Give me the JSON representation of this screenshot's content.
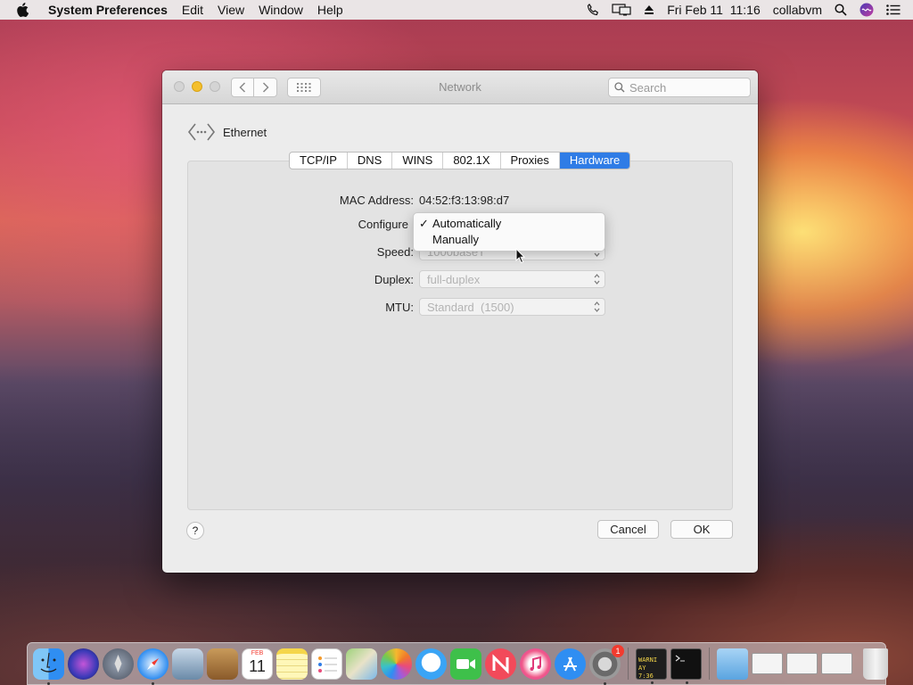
{
  "menubar": {
    "app_name": "System Preferences",
    "items": [
      "Edit",
      "View",
      "Window",
      "Help"
    ],
    "date_time": "Fri Feb 11  11:16",
    "user": "collabvm",
    "icons": [
      "phone-icon",
      "display-icon",
      "eject-icon",
      "spotlight-icon",
      "siri-icon",
      "notification-center-icon"
    ]
  },
  "window": {
    "title": "Network",
    "search_placeholder": "Search",
    "interface": "Ethernet",
    "tabs": [
      "TCP/IP",
      "DNS",
      "WINS",
      "802.1X",
      "Proxies",
      "Hardware"
    ],
    "active_tab": "Hardware",
    "fields": {
      "mac_label": "MAC Address:",
      "mac_value": "04:52:f3:13:98:d7",
      "configure_label": "Configure",
      "speed_label": "Speed:",
      "speed_value": "1000baseT",
      "duplex_label": "Duplex:",
      "duplex_value": "full-duplex",
      "mtu_label": "MTU:",
      "mtu_value": "Standard  (1500)"
    },
    "configure_menu": {
      "options": [
        "Automatically",
        "Manually"
      ],
      "checked": "Automatically",
      "check_mark": "✓"
    },
    "help_label": "?",
    "cancel_label": "Cancel",
    "ok_label": "OK"
  },
  "dock": {
    "apps": [
      "finder",
      "siri",
      "launchpad",
      "safari",
      "mail-preview",
      "contacts",
      "calendar",
      "notes",
      "reminders",
      "maps",
      "photos",
      "messages",
      "facetime",
      "news",
      "itunes",
      "app-store",
      "system-preferences",
      "console",
      "terminal"
    ],
    "calendar_month": "FEB",
    "calendar_day": "11",
    "system_prefs_badge": "1",
    "console_text": "WARNI AY 7:36",
    "colors": {
      "accent": "#2f7ce6",
      "badge": "#f23b2f"
    }
  }
}
